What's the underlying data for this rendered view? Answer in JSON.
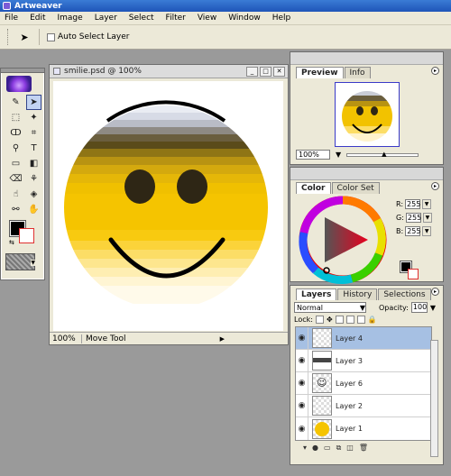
{
  "app": {
    "title": "Artweaver"
  },
  "menu": [
    "File",
    "Edit",
    "Image",
    "Layer",
    "Select",
    "Filter",
    "View",
    "Window",
    "Help"
  ],
  "options": {
    "tool_icon": "move-tool-icon",
    "auto_select_label": "Auto Select Layer",
    "auto_select_checked": false
  },
  "toolbox": {
    "tools": [
      "paint-brush-icon",
      "move-arrow-icon",
      "marquee-rect-icon",
      "magic-wand-icon",
      "lasso-icon",
      "crop-icon",
      "eyedropper-icon",
      "text-tool-icon",
      "rectangle-icon",
      "gradient-icon",
      "eraser-icon",
      "clone-stamp-icon",
      "smudge-icon",
      "paint-bucket-icon",
      "zoom-icon",
      "hand-icon"
    ],
    "selected_tool_index": 1
  },
  "document": {
    "title": "smilie.psd @ 100%",
    "zoom": "100%",
    "status_tool": "Move Tool"
  },
  "preview_panel": {
    "tabs": [
      "Preview",
      "Info"
    ],
    "active_tab": "Preview",
    "zoom": "100%"
  },
  "color_panel": {
    "tabs": [
      "Color",
      "Color Set"
    ],
    "active_tab": "Color",
    "r_label": "R:",
    "r": "255",
    "g_label": "G:",
    "g": "255",
    "b_label": "B:",
    "b": "255"
  },
  "layers_panel": {
    "tabs": [
      "Layers",
      "History",
      "Selections"
    ],
    "active_tab": "Layers",
    "blend_mode": "Normal",
    "opacity_label": "Opacity:",
    "opacity": "100",
    "lock_label": "Lock:",
    "layers": [
      {
        "name": "Layer 4",
        "selected": true
      },
      {
        "name": "Layer 3",
        "selected": false
      },
      {
        "name": "Layer 6",
        "selected": false
      },
      {
        "name": "Layer 2",
        "selected": false
      },
      {
        "name": "Layer 1",
        "selected": false
      }
    ]
  },
  "colors": {
    "accent": "#33458b",
    "selection": "#a6c0e3",
    "smile_yellow": "#f5c400"
  }
}
